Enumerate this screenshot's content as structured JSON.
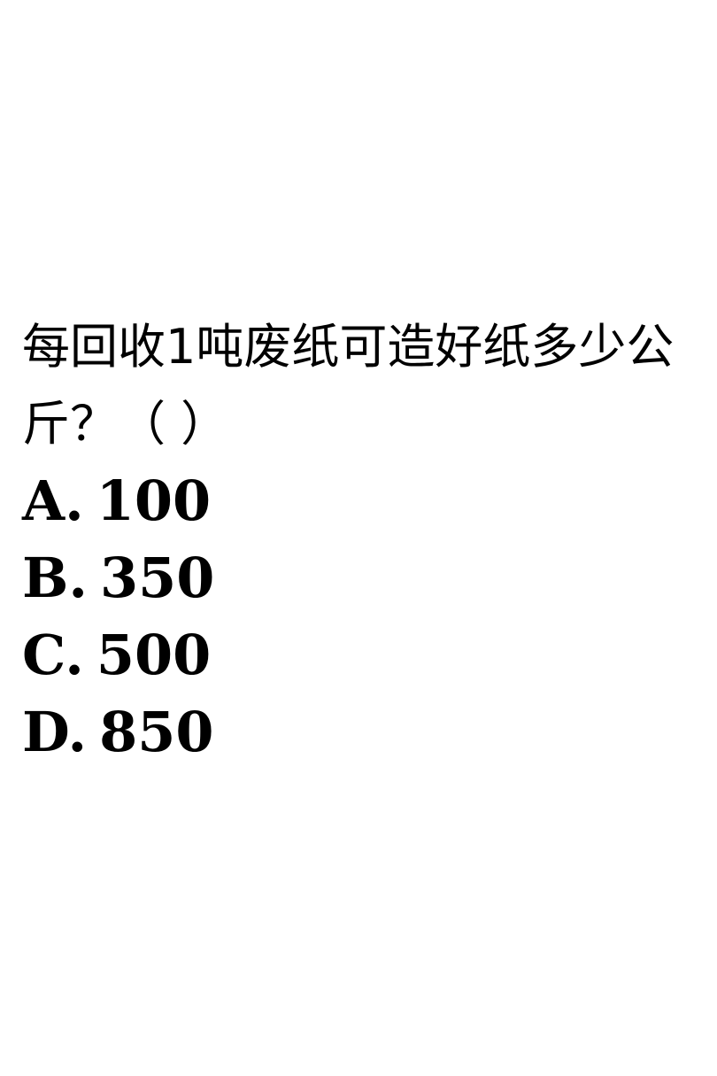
{
  "question": {
    "text": "每回收1吨废纸可造好纸多少公斤？（ ）"
  },
  "options": [
    {
      "label": "A.",
      "value": "100"
    },
    {
      "label": "B.",
      "value": "350"
    },
    {
      "label": "C.",
      "value": "500"
    },
    {
      "label": "D.",
      "value": "850"
    }
  ]
}
